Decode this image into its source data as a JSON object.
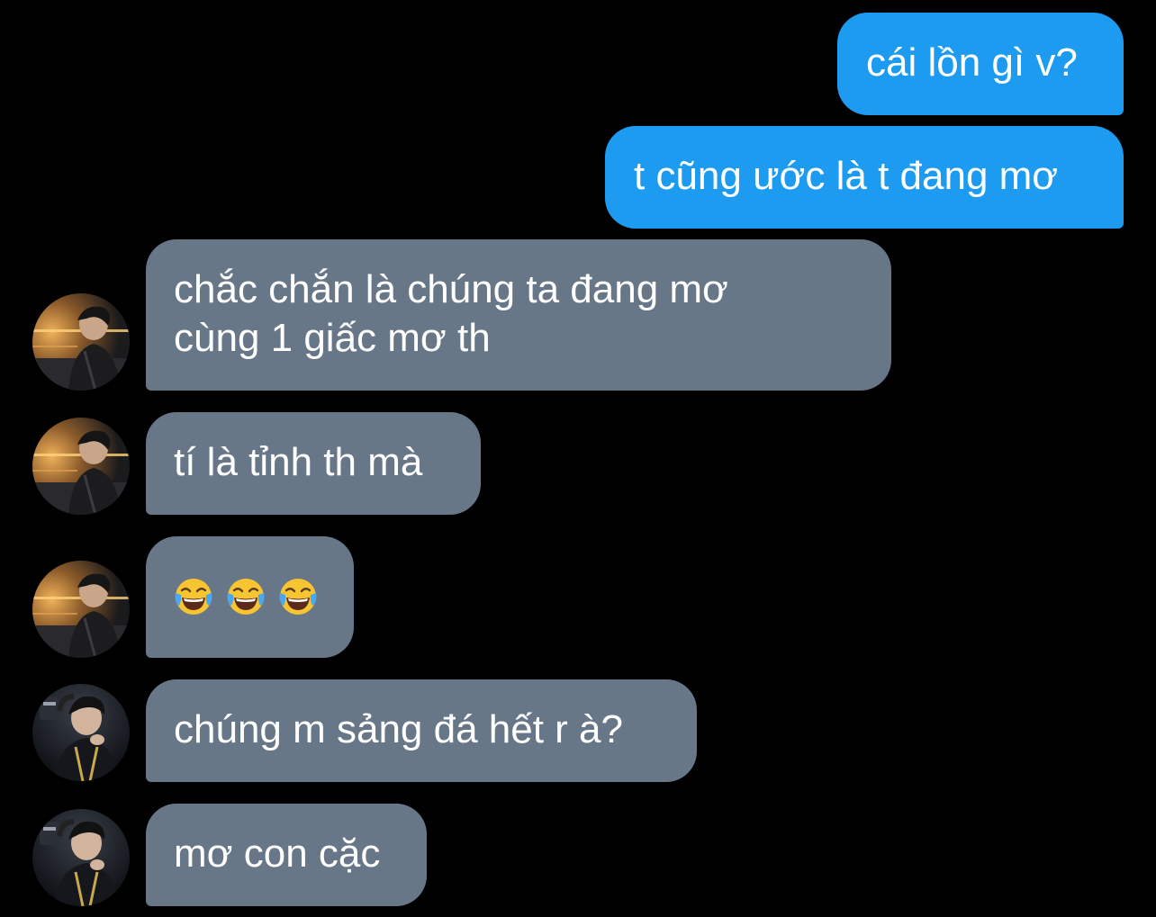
{
  "messages": [
    {
      "id": "m1",
      "direction": "outgoing",
      "text": "cái lồn gì v?"
    },
    {
      "id": "m2",
      "direction": "outgoing",
      "text": "t cũng ước là t đang mơ"
    },
    {
      "id": "m3",
      "direction": "incoming",
      "sender": "user-a",
      "lines": [
        "chắc chắn là chúng ta đang mơ",
        "cùng 1 giấc mơ th"
      ]
    },
    {
      "id": "m4",
      "direction": "incoming",
      "sender": "user-a",
      "text": "tí là tỉnh th mà"
    },
    {
      "id": "m5",
      "direction": "incoming",
      "sender": "user-a",
      "emoji": [
        "face-with-tears-of-joy",
        "face-with-tears-of-joy",
        "face-with-tears-of-joy"
      ]
    },
    {
      "id": "m6",
      "direction": "incoming",
      "sender": "user-b",
      "text": "chúng m sảng đá hết r à?"
    },
    {
      "id": "m7",
      "direction": "incoming",
      "sender": "user-b",
      "text": "mơ con cặc"
    }
  ],
  "colors": {
    "background": "#000000",
    "outgoing_bubble": "#1d9bf0",
    "incoming_bubble": "#687787",
    "text": "#ffffff"
  }
}
